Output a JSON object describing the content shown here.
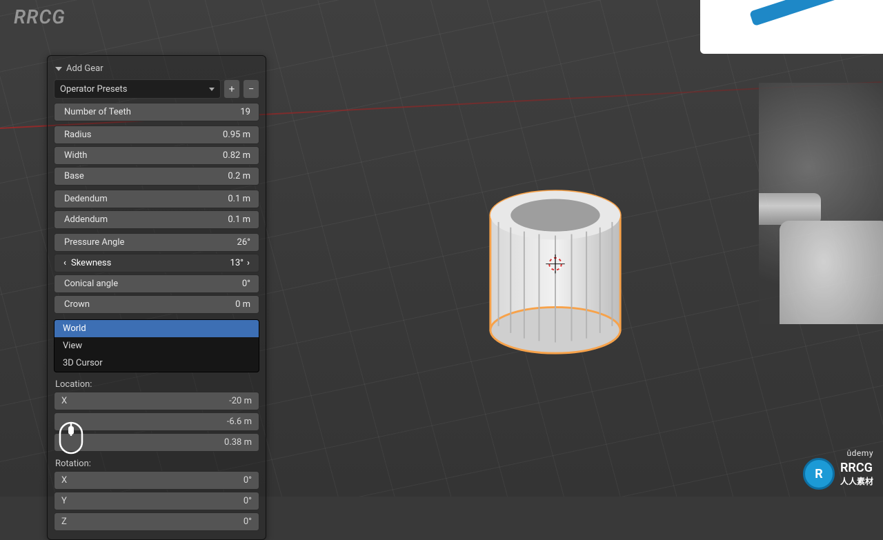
{
  "watermark": {
    "tl": "RRCG",
    "logo_abbrev": "R",
    "logo_text": "RRCG",
    "logo_sub": "人人素材",
    "udemy": "ûdemy"
  },
  "panel": {
    "title": "Add Gear",
    "preset_label": "Operator Presets",
    "plus": "+",
    "minus": "−",
    "rows": {
      "teeth": {
        "label": "Number of Teeth",
        "value": "19"
      },
      "radius": {
        "label": "Radius",
        "value": "0.95 m"
      },
      "width": {
        "label": "Width",
        "value": "0.82 m"
      },
      "base": {
        "label": "Base",
        "value": "0.2 m"
      },
      "ded": {
        "label": "Dedendum",
        "value": "0.1 m"
      },
      "add": {
        "label": "Addendum",
        "value": "0.1 m"
      },
      "pangle": {
        "label": "Pressure Angle",
        "value": "26°"
      },
      "skew": {
        "label": "Skewness",
        "value": "13°"
      },
      "cangle": {
        "label": "Conical angle",
        "value": "0°"
      },
      "crown": {
        "label": "Crown",
        "value": "0 m"
      }
    },
    "align": {
      "world": "World",
      "view": "View",
      "cursor": "3D Cursor"
    },
    "location_label": "Location:",
    "location": {
      "x": {
        "label": "X",
        "value": "-20 m"
      },
      "y": {
        "label": "",
        "value": "-6.6 m"
      },
      "z": {
        "label": "",
        "value": "0.38 m"
      }
    },
    "rotation_label": "Rotation:",
    "rotation": {
      "x": {
        "label": "X",
        "value": "0°"
      },
      "y": {
        "label": "Y",
        "value": "0°"
      },
      "z": {
        "label": "Z",
        "value": "0°"
      }
    },
    "caret_l": "‹",
    "caret_r": "›"
  }
}
